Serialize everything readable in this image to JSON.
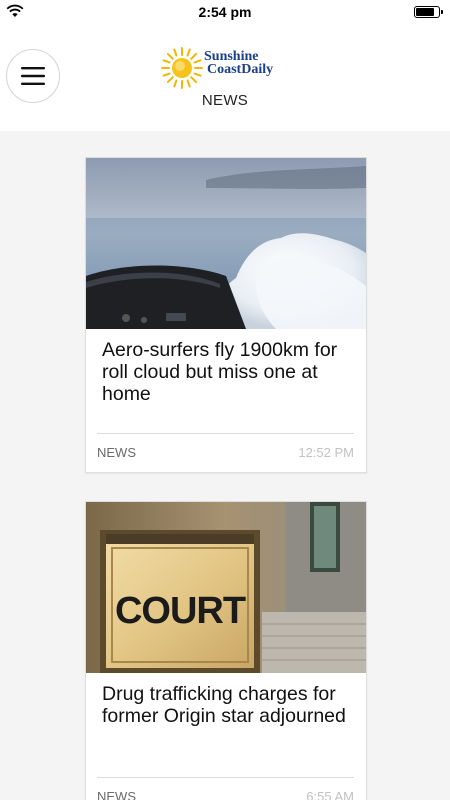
{
  "status_bar": {
    "time": "2:54 pm",
    "battery_level": 0.85
  },
  "header": {
    "logo": {
      "line1": "Sunshine",
      "line2": "CoastDaily"
    },
    "section_title": "NEWS",
    "menu_icon": "hamburger-icon"
  },
  "articles": [
    {
      "headline": "Aero-surfers fly 1900km for roll cloud but miss one at home",
      "category": "NEWS",
      "time": "12:52 PM",
      "image": "aerial view from plane cockpit over roll cloud"
    },
    {
      "headline": "Drug trafficking charges for former Origin star adjourned",
      "category": "NEWS",
      "time": "6:55 AM",
      "image": "COURT sign on stone building",
      "image_sign_text": "COURT"
    }
  ],
  "colors": {
    "logo_blue": "#1c3f8c",
    "sun_yellow": "#f2b705",
    "background": "#f4f4f4"
  }
}
